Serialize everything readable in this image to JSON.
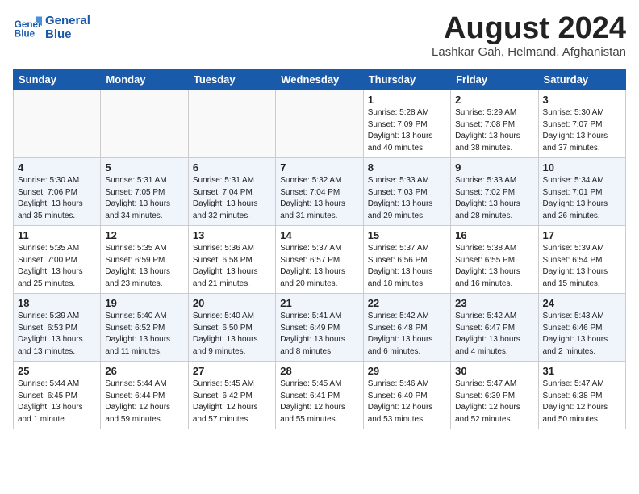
{
  "logo": {
    "line1": "General",
    "line2": "Blue"
  },
  "title": "August 2024",
  "subtitle": "Lashkar Gah, Helmand, Afghanistan",
  "days_of_week": [
    "Sunday",
    "Monday",
    "Tuesday",
    "Wednesday",
    "Thursday",
    "Friday",
    "Saturday"
  ],
  "weeks": [
    [
      {
        "day": "",
        "info": ""
      },
      {
        "day": "",
        "info": ""
      },
      {
        "day": "",
        "info": ""
      },
      {
        "day": "",
        "info": ""
      },
      {
        "day": "1",
        "info": "Sunrise: 5:28 AM\nSunset: 7:09 PM\nDaylight: 13 hours\nand 40 minutes."
      },
      {
        "day": "2",
        "info": "Sunrise: 5:29 AM\nSunset: 7:08 PM\nDaylight: 13 hours\nand 38 minutes."
      },
      {
        "day": "3",
        "info": "Sunrise: 5:30 AM\nSunset: 7:07 PM\nDaylight: 13 hours\nand 37 minutes."
      }
    ],
    [
      {
        "day": "4",
        "info": "Sunrise: 5:30 AM\nSunset: 7:06 PM\nDaylight: 13 hours\nand 35 minutes."
      },
      {
        "day": "5",
        "info": "Sunrise: 5:31 AM\nSunset: 7:05 PM\nDaylight: 13 hours\nand 34 minutes."
      },
      {
        "day": "6",
        "info": "Sunrise: 5:31 AM\nSunset: 7:04 PM\nDaylight: 13 hours\nand 32 minutes."
      },
      {
        "day": "7",
        "info": "Sunrise: 5:32 AM\nSunset: 7:04 PM\nDaylight: 13 hours\nand 31 minutes."
      },
      {
        "day": "8",
        "info": "Sunrise: 5:33 AM\nSunset: 7:03 PM\nDaylight: 13 hours\nand 29 minutes."
      },
      {
        "day": "9",
        "info": "Sunrise: 5:33 AM\nSunset: 7:02 PM\nDaylight: 13 hours\nand 28 minutes."
      },
      {
        "day": "10",
        "info": "Sunrise: 5:34 AM\nSunset: 7:01 PM\nDaylight: 13 hours\nand 26 minutes."
      }
    ],
    [
      {
        "day": "11",
        "info": "Sunrise: 5:35 AM\nSunset: 7:00 PM\nDaylight: 13 hours\nand 25 minutes."
      },
      {
        "day": "12",
        "info": "Sunrise: 5:35 AM\nSunset: 6:59 PM\nDaylight: 13 hours\nand 23 minutes."
      },
      {
        "day": "13",
        "info": "Sunrise: 5:36 AM\nSunset: 6:58 PM\nDaylight: 13 hours\nand 21 minutes."
      },
      {
        "day": "14",
        "info": "Sunrise: 5:37 AM\nSunset: 6:57 PM\nDaylight: 13 hours\nand 20 minutes."
      },
      {
        "day": "15",
        "info": "Sunrise: 5:37 AM\nSunset: 6:56 PM\nDaylight: 13 hours\nand 18 minutes."
      },
      {
        "day": "16",
        "info": "Sunrise: 5:38 AM\nSunset: 6:55 PM\nDaylight: 13 hours\nand 16 minutes."
      },
      {
        "day": "17",
        "info": "Sunrise: 5:39 AM\nSunset: 6:54 PM\nDaylight: 13 hours\nand 15 minutes."
      }
    ],
    [
      {
        "day": "18",
        "info": "Sunrise: 5:39 AM\nSunset: 6:53 PM\nDaylight: 13 hours\nand 13 minutes."
      },
      {
        "day": "19",
        "info": "Sunrise: 5:40 AM\nSunset: 6:52 PM\nDaylight: 13 hours\nand 11 minutes."
      },
      {
        "day": "20",
        "info": "Sunrise: 5:40 AM\nSunset: 6:50 PM\nDaylight: 13 hours\nand 9 minutes."
      },
      {
        "day": "21",
        "info": "Sunrise: 5:41 AM\nSunset: 6:49 PM\nDaylight: 13 hours\nand 8 minutes."
      },
      {
        "day": "22",
        "info": "Sunrise: 5:42 AM\nSunset: 6:48 PM\nDaylight: 13 hours\nand 6 minutes."
      },
      {
        "day": "23",
        "info": "Sunrise: 5:42 AM\nSunset: 6:47 PM\nDaylight: 13 hours\nand 4 minutes."
      },
      {
        "day": "24",
        "info": "Sunrise: 5:43 AM\nSunset: 6:46 PM\nDaylight: 13 hours\nand 2 minutes."
      }
    ],
    [
      {
        "day": "25",
        "info": "Sunrise: 5:44 AM\nSunset: 6:45 PM\nDaylight: 13 hours\nand 1 minute."
      },
      {
        "day": "26",
        "info": "Sunrise: 5:44 AM\nSunset: 6:44 PM\nDaylight: 12 hours\nand 59 minutes."
      },
      {
        "day": "27",
        "info": "Sunrise: 5:45 AM\nSunset: 6:42 PM\nDaylight: 12 hours\nand 57 minutes."
      },
      {
        "day": "28",
        "info": "Sunrise: 5:45 AM\nSunset: 6:41 PM\nDaylight: 12 hours\nand 55 minutes."
      },
      {
        "day": "29",
        "info": "Sunrise: 5:46 AM\nSunset: 6:40 PM\nDaylight: 12 hours\nand 53 minutes."
      },
      {
        "day": "30",
        "info": "Sunrise: 5:47 AM\nSunset: 6:39 PM\nDaylight: 12 hours\nand 52 minutes."
      },
      {
        "day": "31",
        "info": "Sunrise: 5:47 AM\nSunset: 6:38 PM\nDaylight: 12 hours\nand 50 minutes."
      }
    ]
  ]
}
